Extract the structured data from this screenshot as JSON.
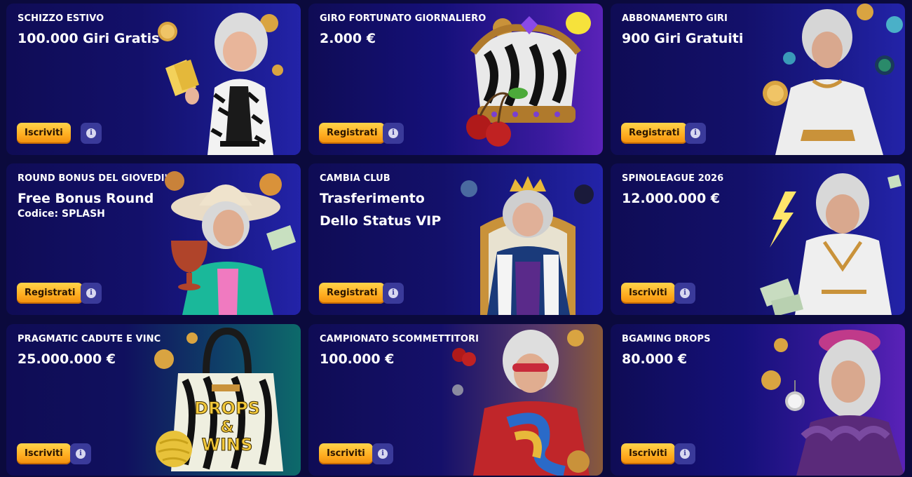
{
  "cards": [
    {
      "subtitle": "SCHIZZO ESTIVO",
      "title": "100.000 Giri Gratis",
      "button": "Iscriviti",
      "art": "woman-zebra-jacket-tickets"
    },
    {
      "subtitle": "GIRO FORTUNATO GIORNALIERO",
      "title": "2.000 €",
      "button": "Registrati",
      "art": "zebra-crown-cherries"
    },
    {
      "subtitle": "ABBONAMENTO GIRI",
      "title": "900 Giri Gratuiti",
      "button": "Registrati",
      "art": "woman-white-dress-orb"
    },
    {
      "subtitle": "ROUND BONUS DEL GIOVEDI'",
      "title": "Free Bonus Round",
      "code": "Codice: SPLASH",
      "button": "Registrati",
      "art": "woman-hat-goblet"
    },
    {
      "subtitle": "CAMBIA CLUB",
      "title": "Trasferimento Dello Status VIP",
      "button": "Registrati",
      "art": "queen-throne"
    },
    {
      "subtitle": "SPINOLEAGUE 2026",
      "title": "12.000.000 €",
      "button": "Iscriviti",
      "art": "goddess-lightning"
    },
    {
      "subtitle": "PRAGMATIC CADUTE E VINC",
      "title": "25.000.000 €",
      "button": "Iscriviti",
      "art": "zebra-bag-drops-wins"
    },
    {
      "subtitle": "CAMPIONATO SCOMMETTITORI",
      "title": "100.000 €",
      "button": "Iscriviti",
      "art": "woman-red-jacket"
    },
    {
      "subtitle": "BGAMING DROPS",
      "title": "80.000 €",
      "button": "Iscriviti",
      "art": "woman-beret-watch"
    }
  ],
  "art_text": {
    "bag_line1": "DROPS",
    "bag_amp": "&",
    "bag_line2": "WINS"
  },
  "info_glyph": "i"
}
